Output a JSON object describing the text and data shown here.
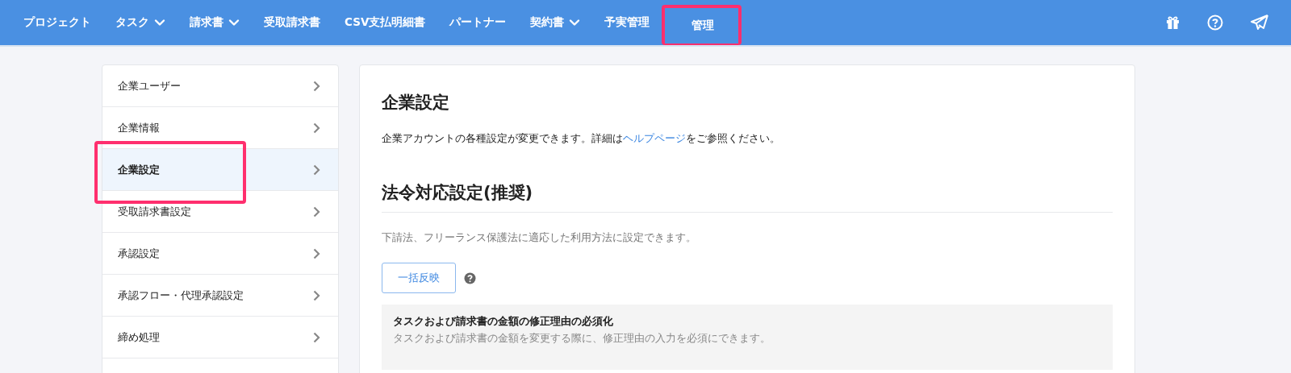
{
  "nav": {
    "items": [
      {
        "label": "プロジェクト",
        "dropdown": false,
        "highlighted": false
      },
      {
        "label": "タスク",
        "dropdown": true,
        "highlighted": false
      },
      {
        "label": "請求書",
        "dropdown": true,
        "highlighted": false
      },
      {
        "label": "受取請求書",
        "dropdown": false,
        "highlighted": false
      },
      {
        "label": "CSV支払明細書",
        "dropdown": false,
        "highlighted": false
      },
      {
        "label": "パートナー",
        "dropdown": false,
        "highlighted": false
      },
      {
        "label": "契約書",
        "dropdown": true,
        "highlighted": false
      },
      {
        "label": "予実管理",
        "dropdown": false,
        "highlighted": false
      },
      {
        "label": "管理",
        "dropdown": false,
        "highlighted": true
      }
    ]
  },
  "sidebar": {
    "items": [
      {
        "label": "企業ユーザー",
        "selected": false,
        "highlighted": false
      },
      {
        "label": "企業情報",
        "selected": false,
        "highlighted": false
      },
      {
        "label": "企業設定",
        "selected": true,
        "highlighted": true
      },
      {
        "label": "受取請求書設定",
        "selected": false,
        "highlighted": false
      },
      {
        "label": "承認設定",
        "selected": false,
        "highlighted": false
      },
      {
        "label": "承認フロー・代理承認設定",
        "selected": false,
        "highlighted": false
      },
      {
        "label": "締め処理",
        "selected": false,
        "highlighted": false
      }
    ]
  },
  "main": {
    "title": "企業設定",
    "description": {
      "before": "企業アカウントの各種設定が変更できます。詳細は",
      "link": "ヘルプページ",
      "after": "をご参照ください。"
    },
    "section": {
      "title": "法令対応設定(推奨)",
      "description": "下請法、フリーランス保護法に適応した利用方法に設定できます。",
      "button": "一括反映",
      "settings": [
        {
          "title": "タスクおよび請求書の金額の修正理由の必須化",
          "description": "タスクおよび請求書の金額を変更する際に、修正理由の入力を必須にできます。"
        }
      ]
    }
  }
}
